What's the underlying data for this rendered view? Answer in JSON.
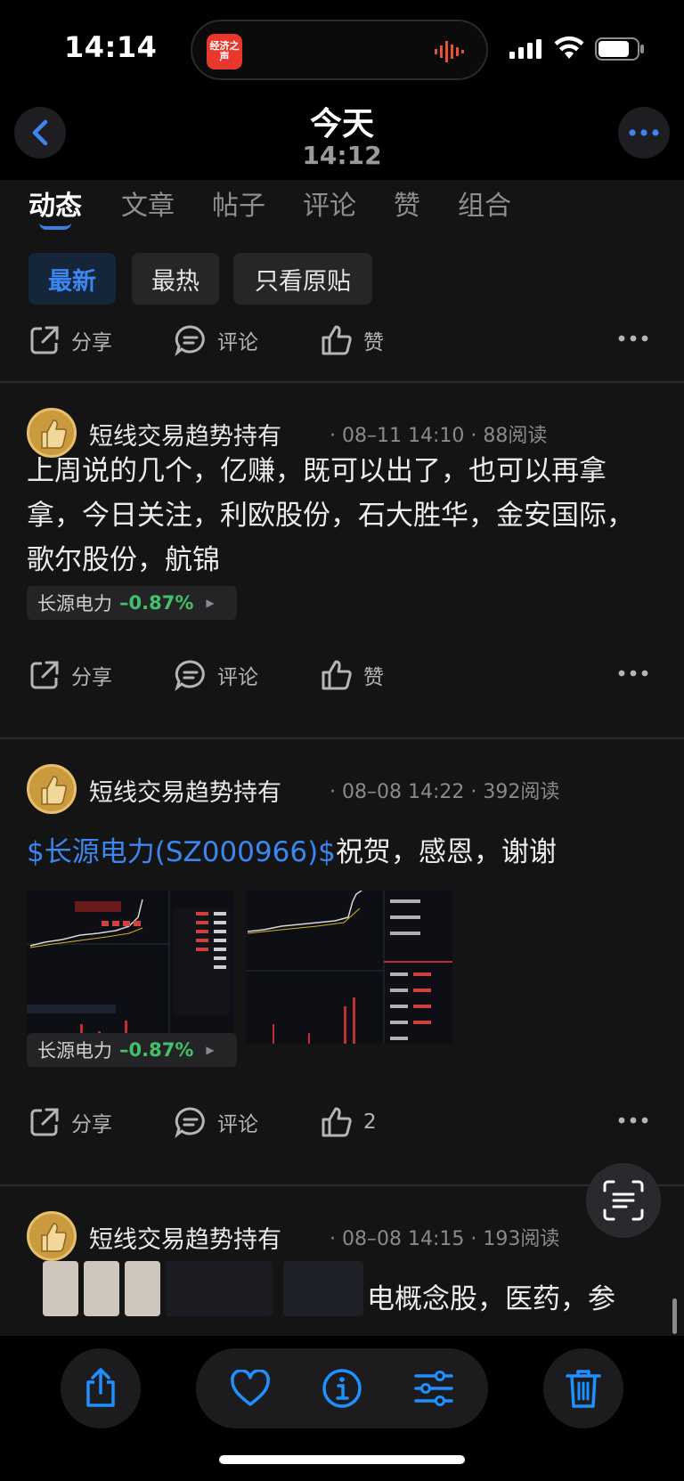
{
  "status_bar": {
    "time": "14:14",
    "app_badge": "经济之声"
  },
  "nav": {
    "title": "今天",
    "subtitle": "14:12"
  },
  "tabs": [
    "动态",
    "文章",
    "帖子",
    "评论",
    "赞",
    "组合"
  ],
  "filters": [
    "最新",
    "最热",
    "只看原贴"
  ],
  "actions": {
    "share": "分享",
    "comment": "评论",
    "like": "赞"
  },
  "posts": [
    {
      "author": "短线交易趋势持有",
      "meta": "· 08–11 14:10 · 88阅读",
      "text": "上周说的几个，亿赚，既可以出了，也可以再拿拿，今日关注，利欧股份，石大胜华，金安国际，歌尔股份，航锦",
      "stock": {
        "name": "长源电力",
        "change": "–0.87%"
      },
      "like_label": "赞"
    },
    {
      "author": "短线交易趋势持有",
      "meta": "· 08–08 14:22 · 392阅读",
      "link_text": "$长源电力(SZ000966)$",
      "text": "祝贺，感恩，谢谢",
      "stock": {
        "name": "长源电力",
        "change": "–0.87%"
      },
      "like_label": "2"
    },
    {
      "author": "短线交易趋势持有",
      "meta": "· 08–08 14:15 · 193阅读",
      "text": "电概念股，医药，参"
    }
  ],
  "colors": {
    "accent": "#3b86f0",
    "down": "#43c06b",
    "background": "#141414"
  }
}
